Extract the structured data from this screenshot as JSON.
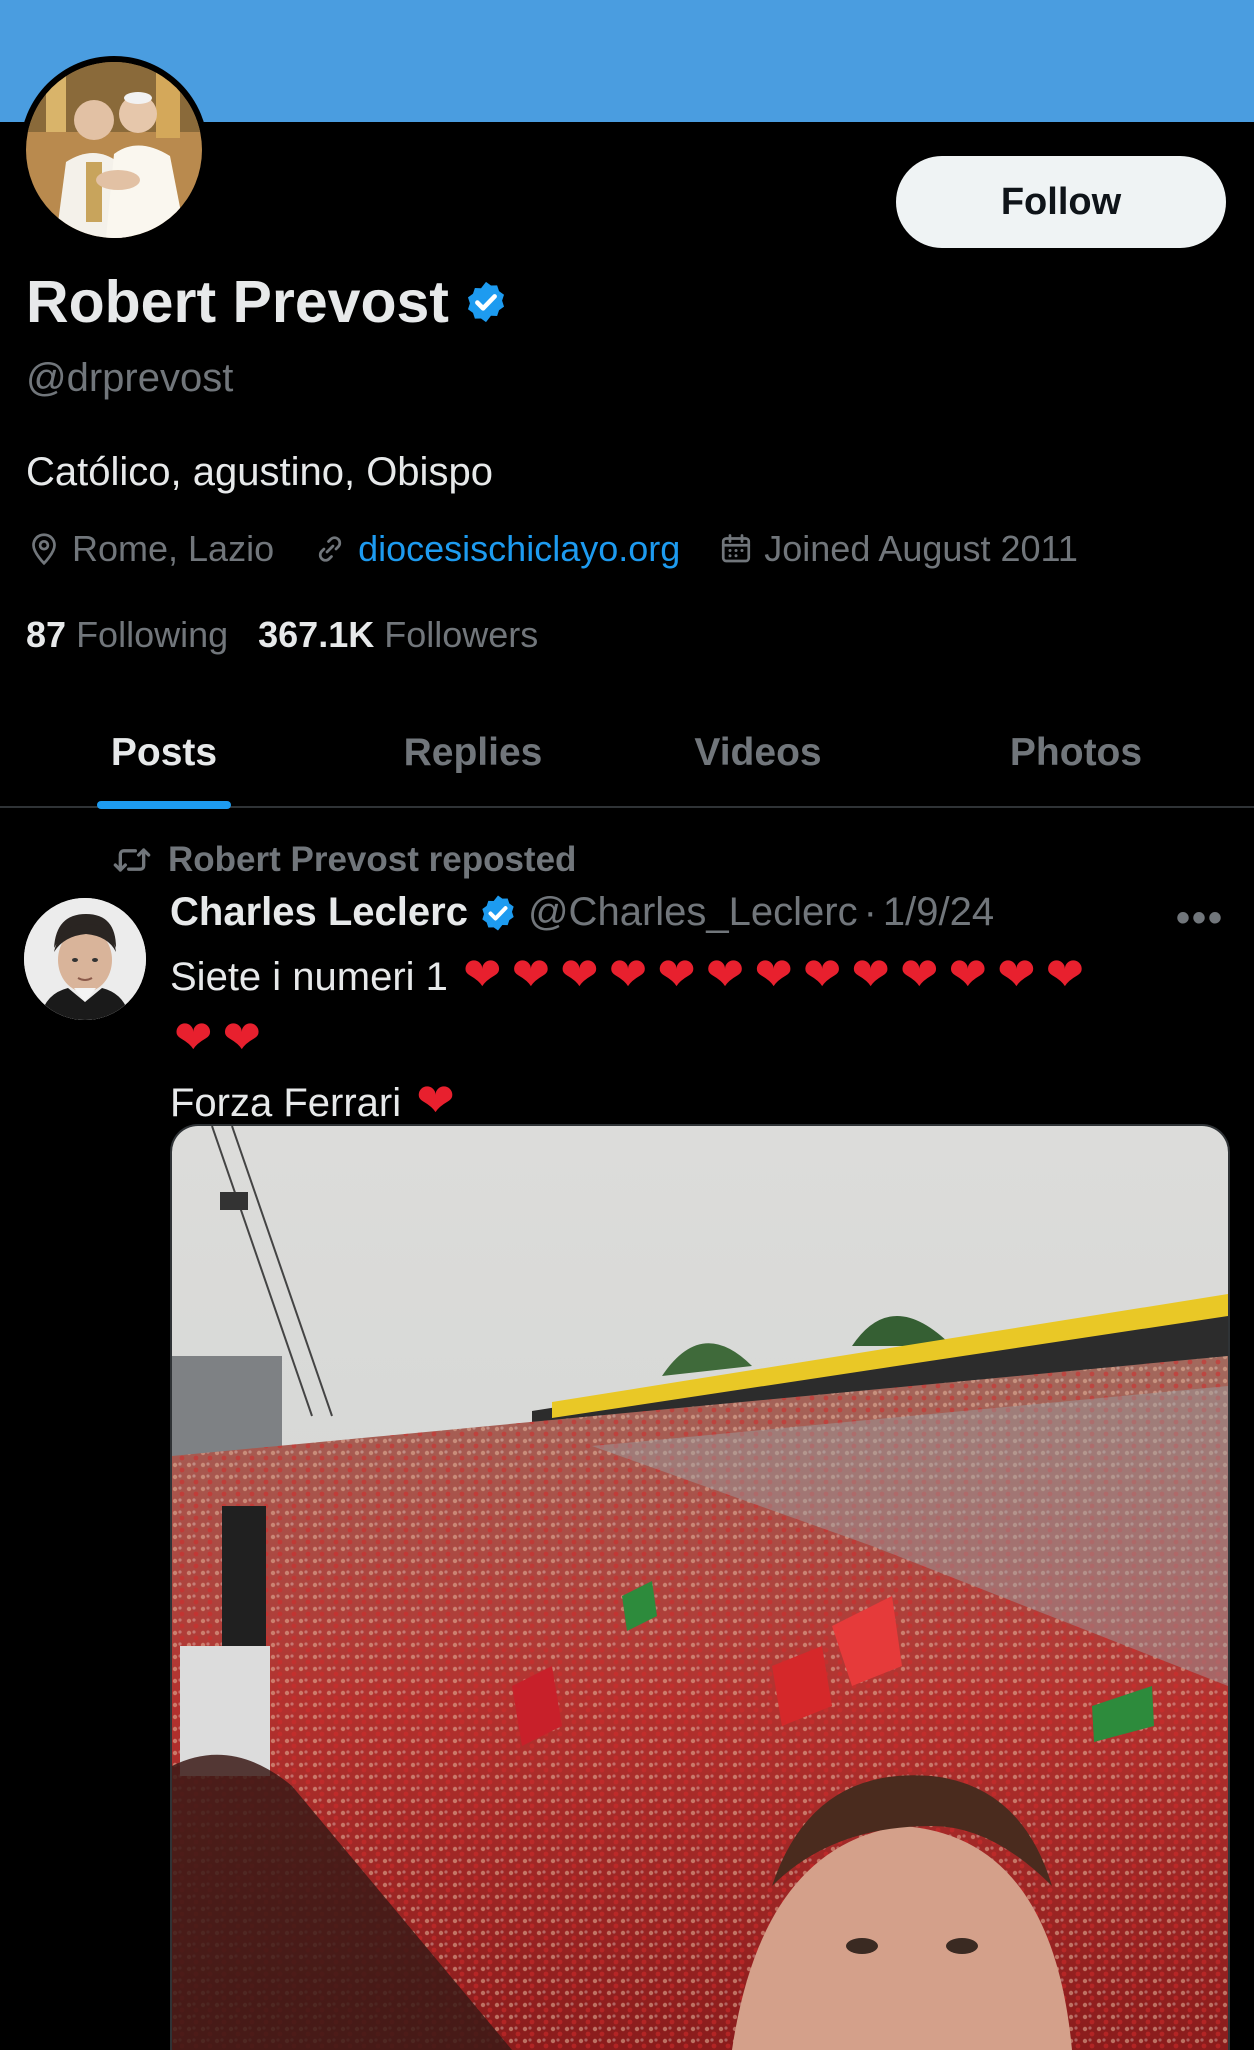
{
  "profile": {
    "follow_label": "Follow",
    "name": "Robert Prevost",
    "handle": "@drprevost",
    "bio": "Católico, agustino, Obispo",
    "location": "Rome, Lazio",
    "website": "diocesischiclayo.org",
    "joined": "Joined August 2011",
    "following_count": "87",
    "following_label": "Following",
    "followers_count": "367.1K",
    "followers_label": "Followers"
  },
  "tabs": [
    {
      "label": "Posts",
      "active": true
    },
    {
      "label": "Replies",
      "active": false
    },
    {
      "label": "Videos",
      "active": false
    },
    {
      "label": "Photos",
      "active": false
    }
  ],
  "post": {
    "repost_label": "Robert Prevost reposted",
    "author_name": "Charles Leclerc",
    "author_handle": "@Charles_Leclerc",
    "separator": "·",
    "date": "1/9/24",
    "more_label": "•••",
    "text_line1": "Siete i numeri 1",
    "heart_glyph": "❤",
    "line1_hearts": 13,
    "line2_hearts": 2,
    "text_line3": "Forza Ferrari",
    "line3_hearts": 1
  },
  "colors": {
    "banner": "#4a9de0",
    "accent": "#1d9bf0",
    "muted": "#71767b",
    "heart": "#e8202e"
  },
  "icons": {
    "verified": "verified-badge-icon",
    "location": "map-pin-icon",
    "link": "link-icon",
    "calendar": "calendar-icon",
    "repost": "repost-icon"
  }
}
